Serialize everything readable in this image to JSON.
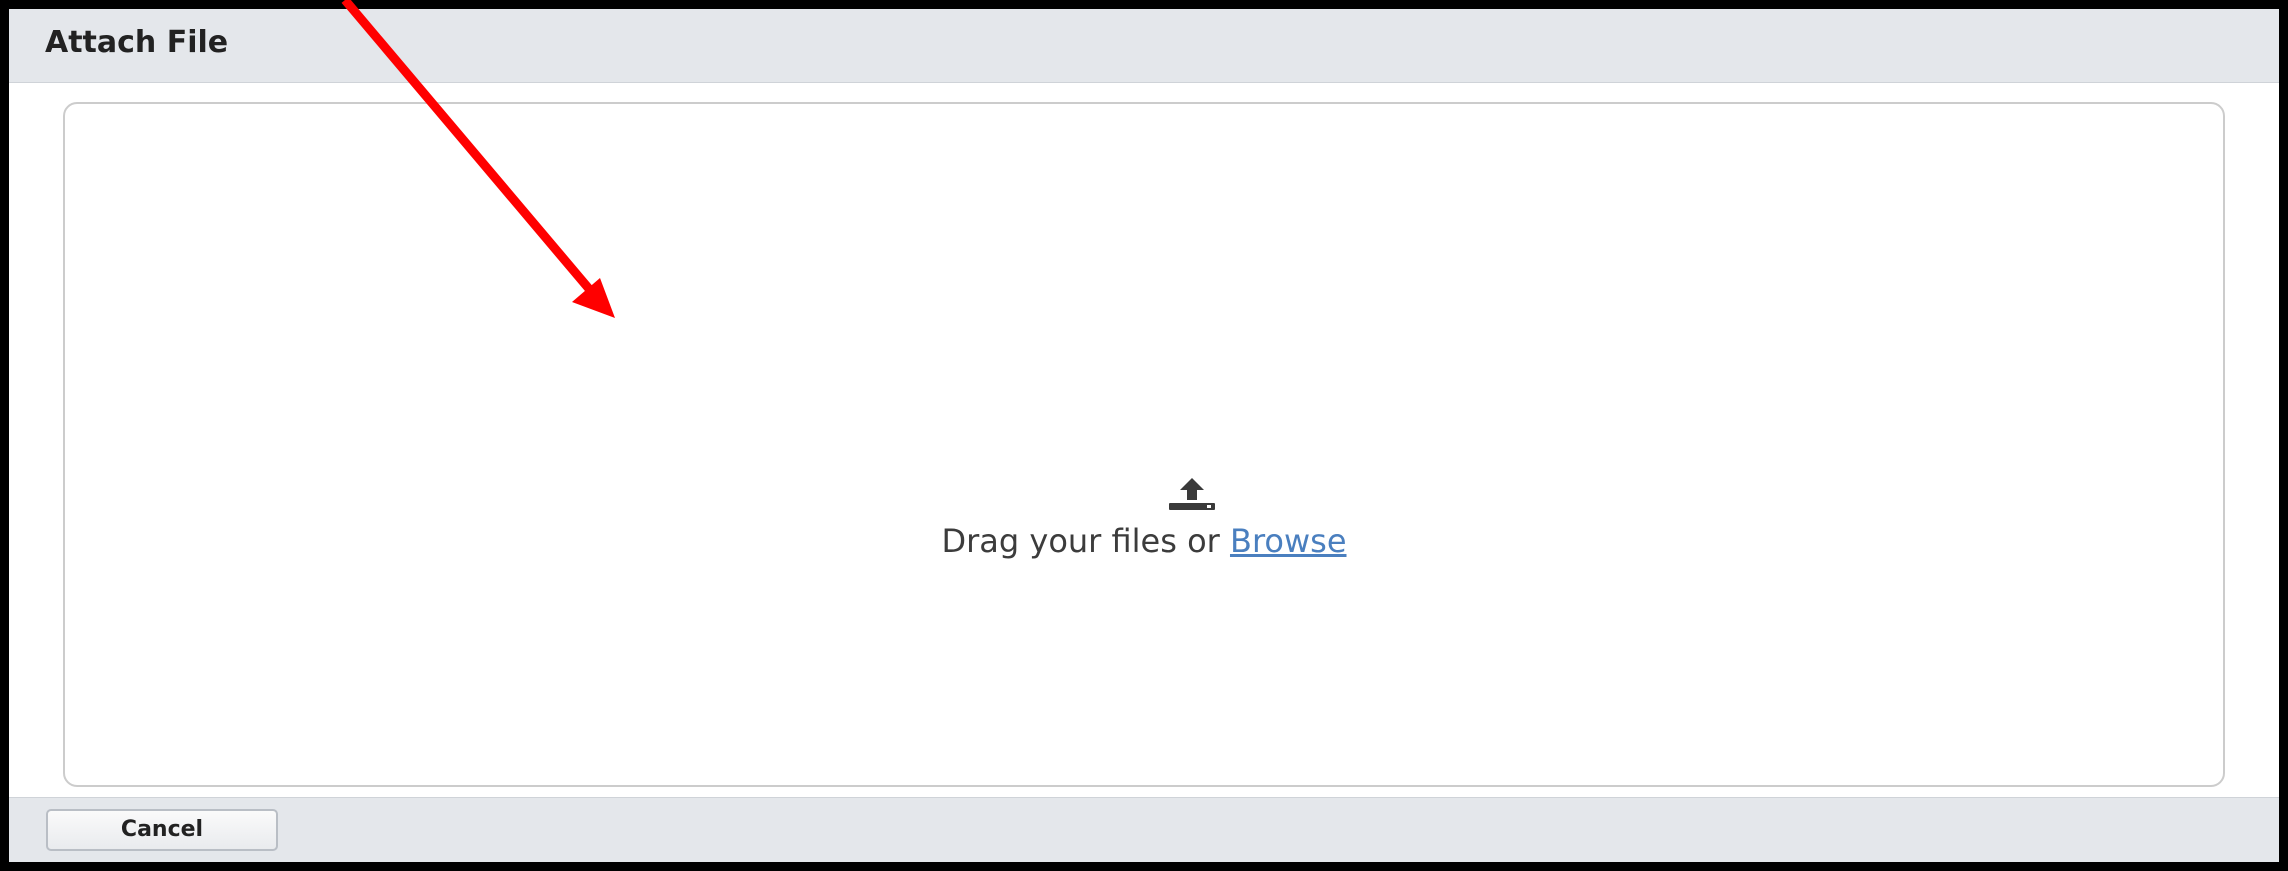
{
  "dialog": {
    "title": "Attach File"
  },
  "dropzone": {
    "icon": "upload-icon",
    "prompt_prefix": "Drag your files or ",
    "browse_label": "Browse"
  },
  "footer": {
    "cancel_label": "Cancel"
  },
  "colors": {
    "title_bar": "#e4e7eb",
    "link": "#4a7fbf",
    "annotation_arrow": "#ff0000"
  }
}
